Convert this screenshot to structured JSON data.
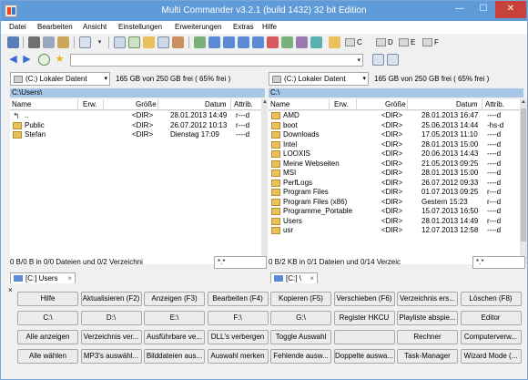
{
  "window": {
    "title": "Multi Commander v3.2.1 (build 1432) 32 bit Edition",
    "minimize": "—",
    "maximize": "☐",
    "close": "✕"
  },
  "menu": [
    "Datei",
    "Bearbeiten",
    "Ansicht",
    "Einstellungen",
    "Erweiterungen",
    "Extras",
    "Hilfe"
  ],
  "toolbar": {
    "drives": [
      {
        "label": "C"
      },
      {
        "label": "D"
      },
      {
        "label": "E"
      },
      {
        "label": "F"
      }
    ],
    "command_line_value": ""
  },
  "columns": {
    "name": "Name",
    "ext": "Erw.",
    "size": "Größe",
    "date": "Datum",
    "attr": "Attrib."
  },
  "left_panel": {
    "drive_select": "(C:) Lokaler Datent",
    "free_info": "165 GB von 250 GB frei ( 65% frei )",
    "path": "C:\\Users\\",
    "files": [
      {
        "name": "..",
        "ext": "",
        "size": "<DIR>",
        "date": "28.01.2013 14:49",
        "attr": "r---d",
        "up": true
      },
      {
        "name": "Public",
        "ext": "",
        "size": "<DIR>",
        "date": "26.07.2012 10:13",
        "attr": "r---d"
      },
      {
        "name": "Stefan",
        "ext": "",
        "size": "<DIR>",
        "date": "Dienstag 17:09",
        "attr": "----d"
      }
    ],
    "status": "0 B/0 B in 0/0 Dateien und 0/2 Verzeichni",
    "filter": "*.*",
    "tab": "[C:] Users"
  },
  "right_panel": {
    "drive_select": "(C:) Lokaler Datent",
    "free_info": "165 GB von 250 GB frei ( 65% frei )",
    "path": "C:\\",
    "files": [
      {
        "name": "AMD",
        "ext": "",
        "size": "<DIR>",
        "date": "28.01.2013 16:47",
        "attr": "----d"
      },
      {
        "name": "boot",
        "ext": "",
        "size": "<DIR>",
        "date": "25.06.2013 14:44",
        "attr": "-hs-d"
      },
      {
        "name": "Downloads",
        "ext": "",
        "size": "<DIR>",
        "date": "17.05.2013 11:10",
        "attr": "----d"
      },
      {
        "name": "Intel",
        "ext": "",
        "size": "<DIR>",
        "date": "28.01.2013 15:00",
        "attr": "----d"
      },
      {
        "name": "LOOXIS",
        "ext": "",
        "size": "<DIR>",
        "date": "20.06.2013 14:43",
        "attr": "----d"
      },
      {
        "name": "Meine Webseiten",
        "ext": "",
        "size": "<DIR>",
        "date": "21.05.2013 09:25",
        "attr": "----d"
      },
      {
        "name": "MSI",
        "ext": "",
        "size": "<DIR>",
        "date": "28.01.2013 15:00",
        "attr": "----d"
      },
      {
        "name": "PerfLogs",
        "ext": "",
        "size": "<DIR>",
        "date": "26.07.2012 09:33",
        "attr": "----d"
      },
      {
        "name": "Program Files",
        "ext": "",
        "size": "<DIR>",
        "date": "01.07.2013 09:25",
        "attr": "r---d"
      },
      {
        "name": "Program Files (x86)",
        "ext": "",
        "size": "<DIR>",
        "date": "Gestern 15:23",
        "attr": "r---d"
      },
      {
        "name": "Programme_Portable",
        "ext": "",
        "size": "<DIR>",
        "date": "15.07.2013 16:50",
        "attr": "----d"
      },
      {
        "name": "Users",
        "ext": "",
        "size": "<DIR>",
        "date": "28.01.2013 14:49",
        "attr": "r---d"
      },
      {
        "name": "usr",
        "ext": "",
        "size": "<DIR>",
        "date": "12.07.2013 12:58",
        "attr": "----d"
      }
    ],
    "status": "0 B/2 KB in 0/1 Dateien und 0/14 Verzeic",
    "filter": "*.*",
    "tab": "[C:] \\"
  },
  "buttons_close": "×",
  "buttons": [
    [
      "Hilfe",
      "Aktualisieren (F2)",
      "Anzeigen (F3)",
      "Bearbeiten (F4)",
      "Kopieren (F5)",
      "Verschieben (F6)",
      "Verzeichnis ers...",
      "Löschen (F8)"
    ],
    [
      "C:\\",
      "D:\\",
      "E:\\",
      "F:\\",
      "G:\\",
      "Register HKCU",
      "Playliste abspie...",
      "Editor"
    ],
    [
      "Alle anzeigen",
      "Verzeichnis ver...",
      "Ausführbare ve...",
      "DLL's verbergen",
      "Toggle Auswahl",
      "",
      "Rechner",
      "Computerverw..."
    ],
    [
      "Alle wählen",
      "MP3's auswähl...",
      "Bilddateien aus...",
      "Auswahl merken",
      "Fehlende ausw...",
      "Doppelte auswa...",
      "Task-Manager",
      "Wizard Mode (..."
    ]
  ]
}
